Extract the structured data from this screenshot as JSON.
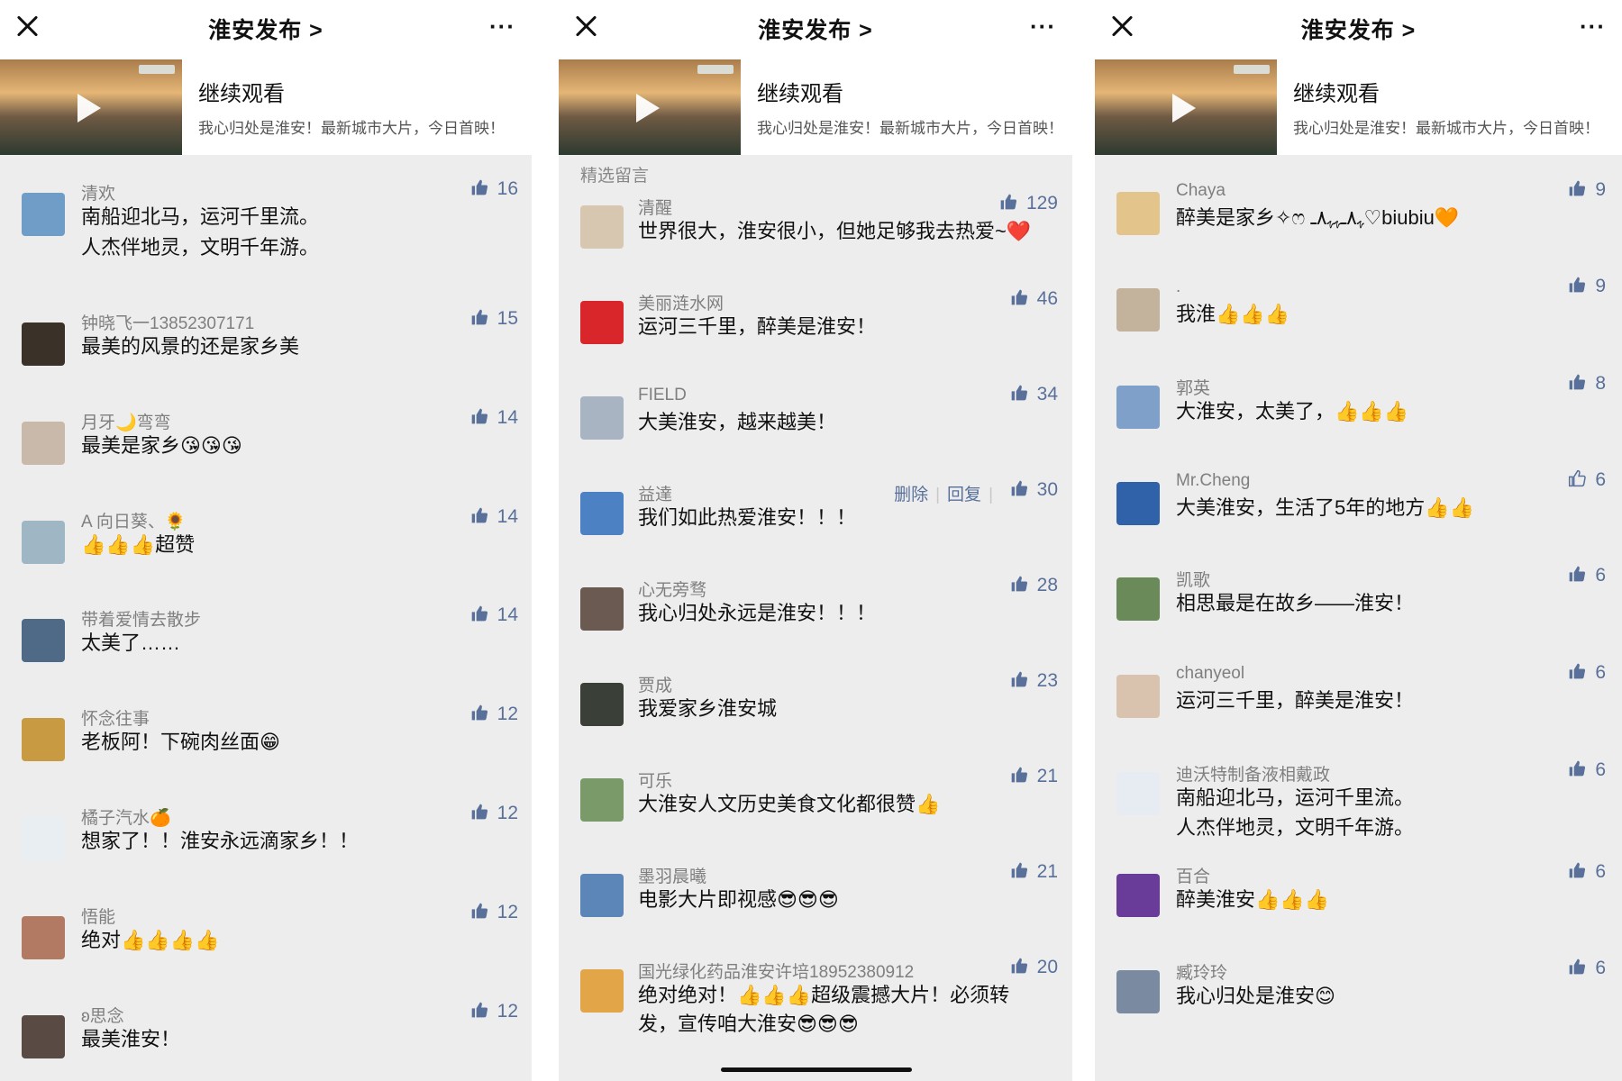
{
  "panels": [
    {
      "header": {
        "title": "淮安发布 >",
        "more": "···"
      },
      "video": {
        "title": "继续观看",
        "desc": "我心归处是淮安！最新城市大片，今日首映！"
      },
      "section": "",
      "comments": [
        {
          "name": "清欢",
          "lines": [
            "南船迎北马，运河千里流。",
            "人杰伴地灵，文明千年游。"
          ],
          "likes": "16",
          "avatar": "#6f9dc7"
        },
        {
          "name": "钟晓飞一13852307171",
          "lines": [
            "最美的风景的还是家乡美"
          ],
          "likes": "15",
          "avatar": "#3a3228"
        },
        {
          "name": "月牙🌙弯弯",
          "lines": [
            "最美是家乡😘😘😘"
          ],
          "likes": "14",
          "avatar": "#c8b9aa"
        },
        {
          "name": "A 向日葵、🌻",
          "lines": [
            "👍👍👍超赞"
          ],
          "likes": "14",
          "avatar": "#9fb6c4"
        },
        {
          "name": "带着爱情去散步",
          "lines": [
            "太美了……"
          ],
          "likes": "14",
          "avatar": "#4e6a86"
        },
        {
          "name": "怀念往事",
          "lines": [
            "老板阿！下碗肉丝面😁"
          ],
          "likes": "12",
          "avatar": "#c89a42"
        },
        {
          "name": "橘子汽水🍊",
          "lines": [
            "想家了！！淮安永远滴家乡！！"
          ],
          "likes": "12",
          "avatar": "#e8eef2"
        },
        {
          "name": "悟能",
          "lines": [
            "绝对👍👍👍👍"
          ],
          "likes": "12",
          "avatar": "#b27a62"
        },
        {
          "name": "ʚ思念",
          "lines": [
            "最美淮安！"
          ],
          "likes": "12",
          "avatar": "#5a4a44"
        }
      ]
    },
    {
      "header": {
        "title": "淮安发布 >",
        "more": "···"
      },
      "video": {
        "title": "继续观看",
        "desc": "我心归处是淮安！最新城市大片，今日首映！"
      },
      "section": "精选留言",
      "comments": [
        {
          "name": "清醒",
          "lines": [
            "世界很大，淮安很小，但她足够我去热爱~❤️"
          ],
          "likes": "129",
          "avatar": "#d8c7b0"
        },
        {
          "name": "美丽涟水网",
          "lines": [
            "运河三千里，醉美是淮安！"
          ],
          "likes": "46",
          "avatar": "#d8262a"
        },
        {
          "name": "FIELD",
          "lines": [
            "大美淮安，越来越美！"
          ],
          "likes": "34",
          "avatar": "#a9b4c2"
        },
        {
          "name": "益達",
          "lines": [
            "我们如此热爱淮安！！！"
          ],
          "likes": "30",
          "avatar": "#4c82c4",
          "actions": [
            "删除",
            "回复"
          ]
        },
        {
          "name": "心无旁骛",
          "lines": [
            "我心归处永远是淮安！！！"
          ],
          "likes": "28",
          "avatar": "#6a5a52"
        },
        {
          "name": "贾成",
          "lines": [
            "我爱家乡淮安城"
          ],
          "likes": "23",
          "avatar": "#3a4038"
        },
        {
          "name": "可乐",
          "lines": [
            "大淮安人文历史美食文化都很赞👍"
          ],
          "likes": "21",
          "avatar": "#7a9a6a"
        },
        {
          "name": "墨羽晨曦",
          "lines": [
            "电影大片即视感😎😎😎"
          ],
          "likes": "21",
          "avatar": "#5c86b8"
        },
        {
          "name": "国光绿化药品淮安许培18952380912",
          "lines": [
            "绝对绝对！👍👍👍超级震撼大片！必须转",
            "发，宣传咱大淮安😎😎😎"
          ],
          "likes": "20",
          "avatar": "#e2a648"
        }
      ]
    },
    {
      "header": {
        "title": "淮安发布 >",
        "more": "···"
      },
      "video": {
        "title": "继续观看",
        "desc": "我心归处是淮安！最新城市大片，今日首映！"
      },
      "section": "",
      "comments": [
        {
          "name": "Chaya",
          "lines": [
            "醉美是家乡✧ෆ ﮩ٨ـﮩﮩ٨ـ♡biubiu🧡"
          ],
          "likes": "9",
          "avatar": "#e3c48a"
        },
        {
          "name": ".",
          "lines": [
            "我淮👍👍👍"
          ],
          "likes": "9",
          "avatar": "#c4b39c"
        },
        {
          "name": "郭英",
          "lines": [
            "大淮安，太美了，👍👍👍"
          ],
          "likes": "8",
          "avatar": "#7fa0c8"
        },
        {
          "name": "Mr.Cheng",
          "lines": [
            "大美淮安，生活了5年的地方👍👍"
          ],
          "likes": "6",
          "avatar": "#2f62a8",
          "outline": true
        },
        {
          "name": "凯歌",
          "lines": [
            "相思最是在故乡——淮安！"
          ],
          "likes": "6",
          "avatar": "#6b8a5a"
        },
        {
          "name": "chanyeol",
          "lines": [
            "运河三千里，醉美是淮安！"
          ],
          "likes": "6",
          "avatar": "#d9c2ae"
        },
        {
          "name": "迪沃特制备液相戴政",
          "lines": [
            "南船迎北马，运河千里流。",
            "人杰伴地灵，文明千年游。"
          ],
          "likes": "6",
          "avatar": "#e6ecf2"
        },
        {
          "name": "百合",
          "lines": [
            "醉美淮安👍👍👍"
          ],
          "likes": "6",
          "avatar": "#6a3c9a"
        },
        {
          "name": "臧玲玲",
          "lines": [
            "我心归处是淮安😊"
          ],
          "likes": "6",
          "avatar": "#7a8aa0"
        }
      ]
    }
  ],
  "colors": {
    "like": "#58709a",
    "background": "#ededed",
    "name": "#7f7f7f"
  }
}
